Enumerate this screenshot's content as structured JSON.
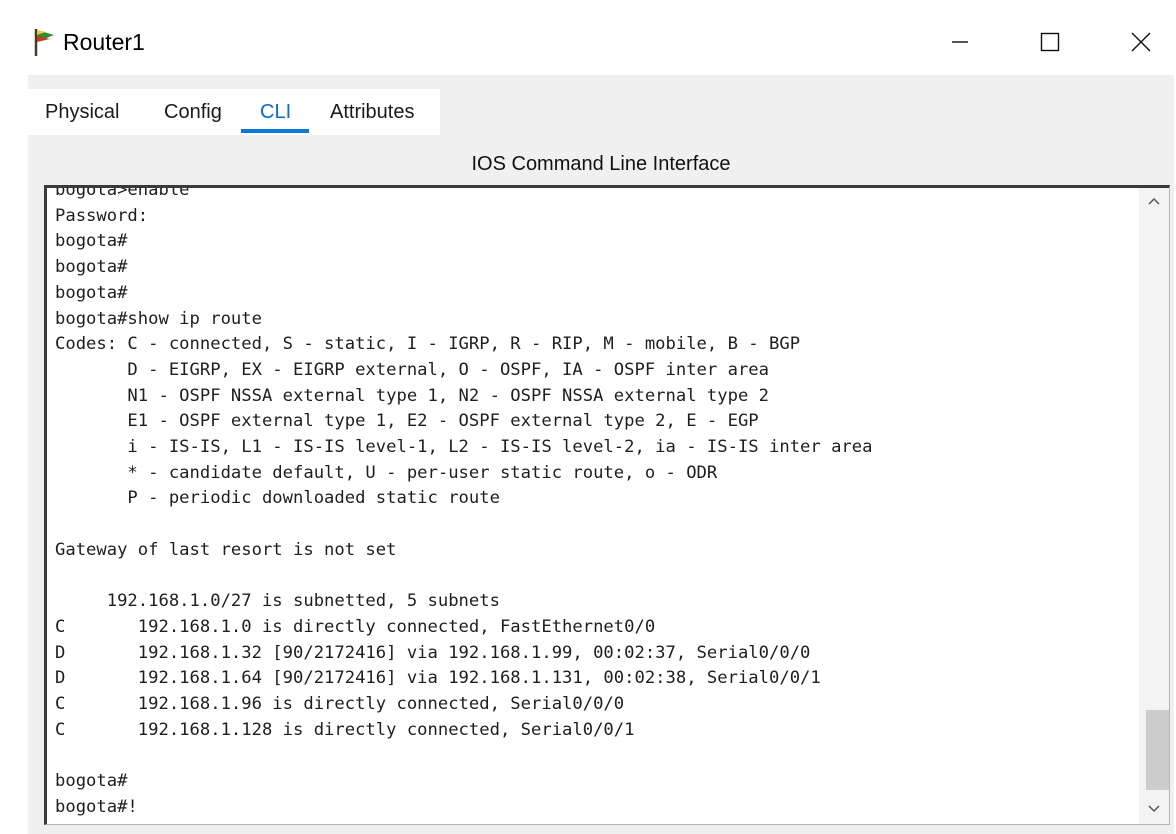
{
  "window": {
    "title": "Router1",
    "icon": "router-app-icon",
    "controls": [
      "minimize-icon",
      "maximize-icon",
      "close-icon"
    ]
  },
  "tabs": [
    {
      "label": "Physical",
      "active": false
    },
    {
      "label": "Config",
      "active": false
    },
    {
      "label": "CLI",
      "active": true
    },
    {
      "label": "Attributes",
      "active": false
    }
  ],
  "cli": {
    "heading": "IOS Command Line Interface",
    "lines": [
      "bogota>enable",
      "Password:",
      "bogota#",
      "bogota#",
      "bogota#",
      "bogota#show ip route",
      "Codes: C - connected, S - static, I - IGRP, R - RIP, M - mobile, B - BGP",
      "       D - EIGRP, EX - EIGRP external, O - OSPF, IA - OSPF inter area",
      "       N1 - OSPF NSSA external type 1, N2 - OSPF NSSA external type 2",
      "       E1 - OSPF external type 1, E2 - OSPF external type 2, E - EGP",
      "       i - IS-IS, L1 - IS-IS level-1, L2 - IS-IS level-2, ia - IS-IS inter area",
      "       * - candidate default, U - per-user static route, o - ODR",
      "       P - periodic downloaded static route",
      "",
      "Gateway of last resort is not set",
      "",
      "     192.168.1.0/27 is subnetted, 5 subnets",
      "C       192.168.1.0 is directly connected, FastEthernet0/0",
      "D       192.168.1.32 [90/2172416] via 192.168.1.99, 00:02:37, Serial0/0/0",
      "D       192.168.1.64 [90/2172416] via 192.168.1.131, 00:02:38, Serial0/0/1",
      "C       192.168.1.96 is directly connected, Serial0/0/0",
      "C       192.168.1.128 is directly connected, Serial0/0/1",
      "",
      "bogota#",
      "bogota#!"
    ]
  },
  "colors": {
    "active_tab": "#0a6bc9",
    "tab_underline": "#0a7ad6",
    "panel_bg": "#f0f0f0"
  }
}
